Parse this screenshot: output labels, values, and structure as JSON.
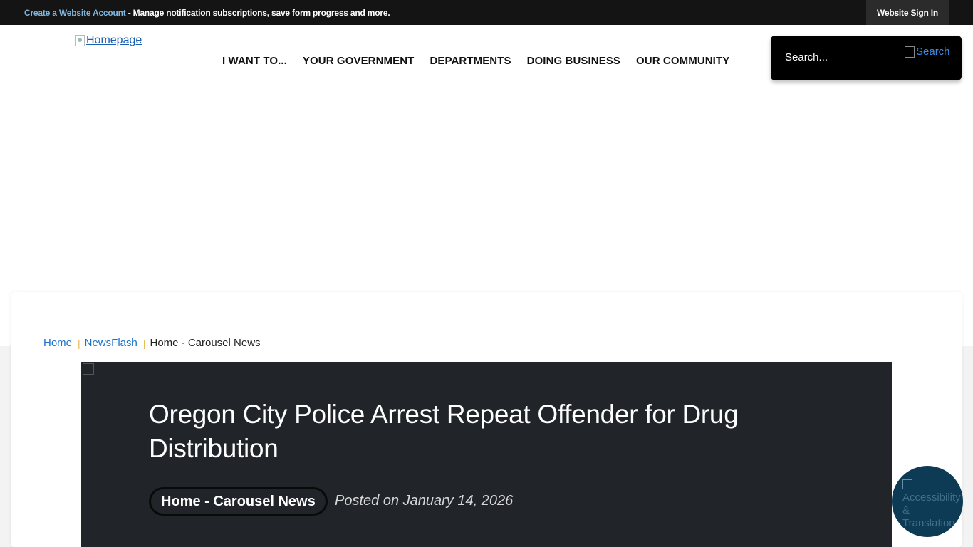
{
  "topbar": {
    "create_account_link": "Create a Website Account",
    "create_account_text": " - Manage notification subscriptions, save form progress and more.",
    "signin_label": "Website Sign In"
  },
  "header": {
    "logo_alt": "Homepage",
    "nav": [
      "I WANT TO...",
      "YOUR GOVERNMENT",
      "DEPARTMENTS",
      "DOING BUSINESS",
      "OUR COMMUNITY"
    ],
    "search": {
      "placeholder": "Search...",
      "button_alt": "Search"
    }
  },
  "breadcrumb": {
    "items": [
      "Home",
      "NewsFlash"
    ],
    "current": "Home - Carousel News"
  },
  "article": {
    "title": "Oregon City Police Arrest Repeat Offender for Drug Distribution",
    "category": "Home - Carousel News",
    "posted": "Posted on January 14, 2026"
  },
  "accessibility": {
    "alt": "Accessibility & Translation"
  }
}
